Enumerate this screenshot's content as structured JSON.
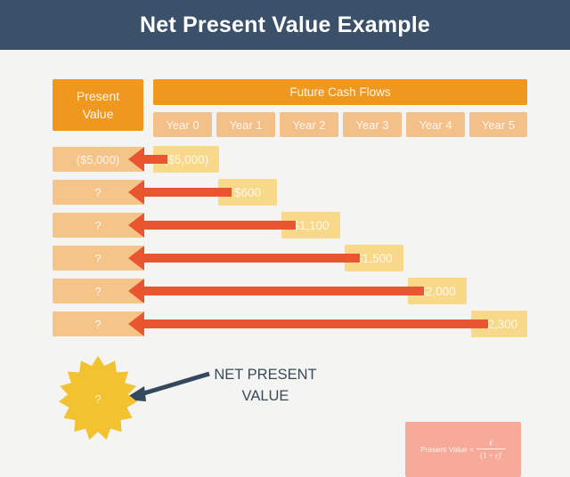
{
  "title": {
    "text": "Net Present Value Example",
    "bar_color": "#3a5169",
    "text_color": "#ffffff"
  },
  "background_color": "#f4f4f2",
  "headers": {
    "present_value": "Present\nValue",
    "present_value_line1": "Present",
    "present_value_line2": "Value",
    "future_cash_flows": "Future Cash Flows",
    "header_color": "#f0971f"
  },
  "year_columns": [
    {
      "label": "Year 0"
    },
    {
      "label": "Year 1"
    },
    {
      "label": "Year 2"
    },
    {
      "label": "Year 3"
    },
    {
      "label": "Year 4"
    },
    {
      "label": "Year 5"
    }
  ],
  "rows": [
    {
      "present_value": "($5,000)",
      "cash_flow": "($5,000)",
      "year_index": 0
    },
    {
      "present_value": "?",
      "cash_flow": "$600",
      "year_index": 1
    },
    {
      "present_value": "?",
      "cash_flow": "$1,100",
      "year_index": 2
    },
    {
      "present_value": "?",
      "cash_flow": "$1,500",
      "year_index": 3
    },
    {
      "present_value": "?",
      "cash_flow": "$2,000",
      "year_index": 4
    },
    {
      "present_value": "?",
      "cash_flow": "$2,300",
      "year_index": 5
    }
  ],
  "npv": {
    "burst_label": "?",
    "callout_line1": "NET PRESENT",
    "callout_line2": "VALUE",
    "burst_color": "#f2c230",
    "callout_color": "#3a4a58"
  },
  "formula": {
    "lhs": "Present Value =",
    "numerator": "c",
    "denominator_base": "(1 + r)",
    "denominator_exponent": "t",
    "box_color": "#f7aa99"
  },
  "colors": {
    "pv_bar": "#f5c489",
    "year_cell": "#f3c08a",
    "cash_flow_box": "#f8d98a",
    "arrow": "#e8552f",
    "header_orange": "#f0971f"
  }
}
